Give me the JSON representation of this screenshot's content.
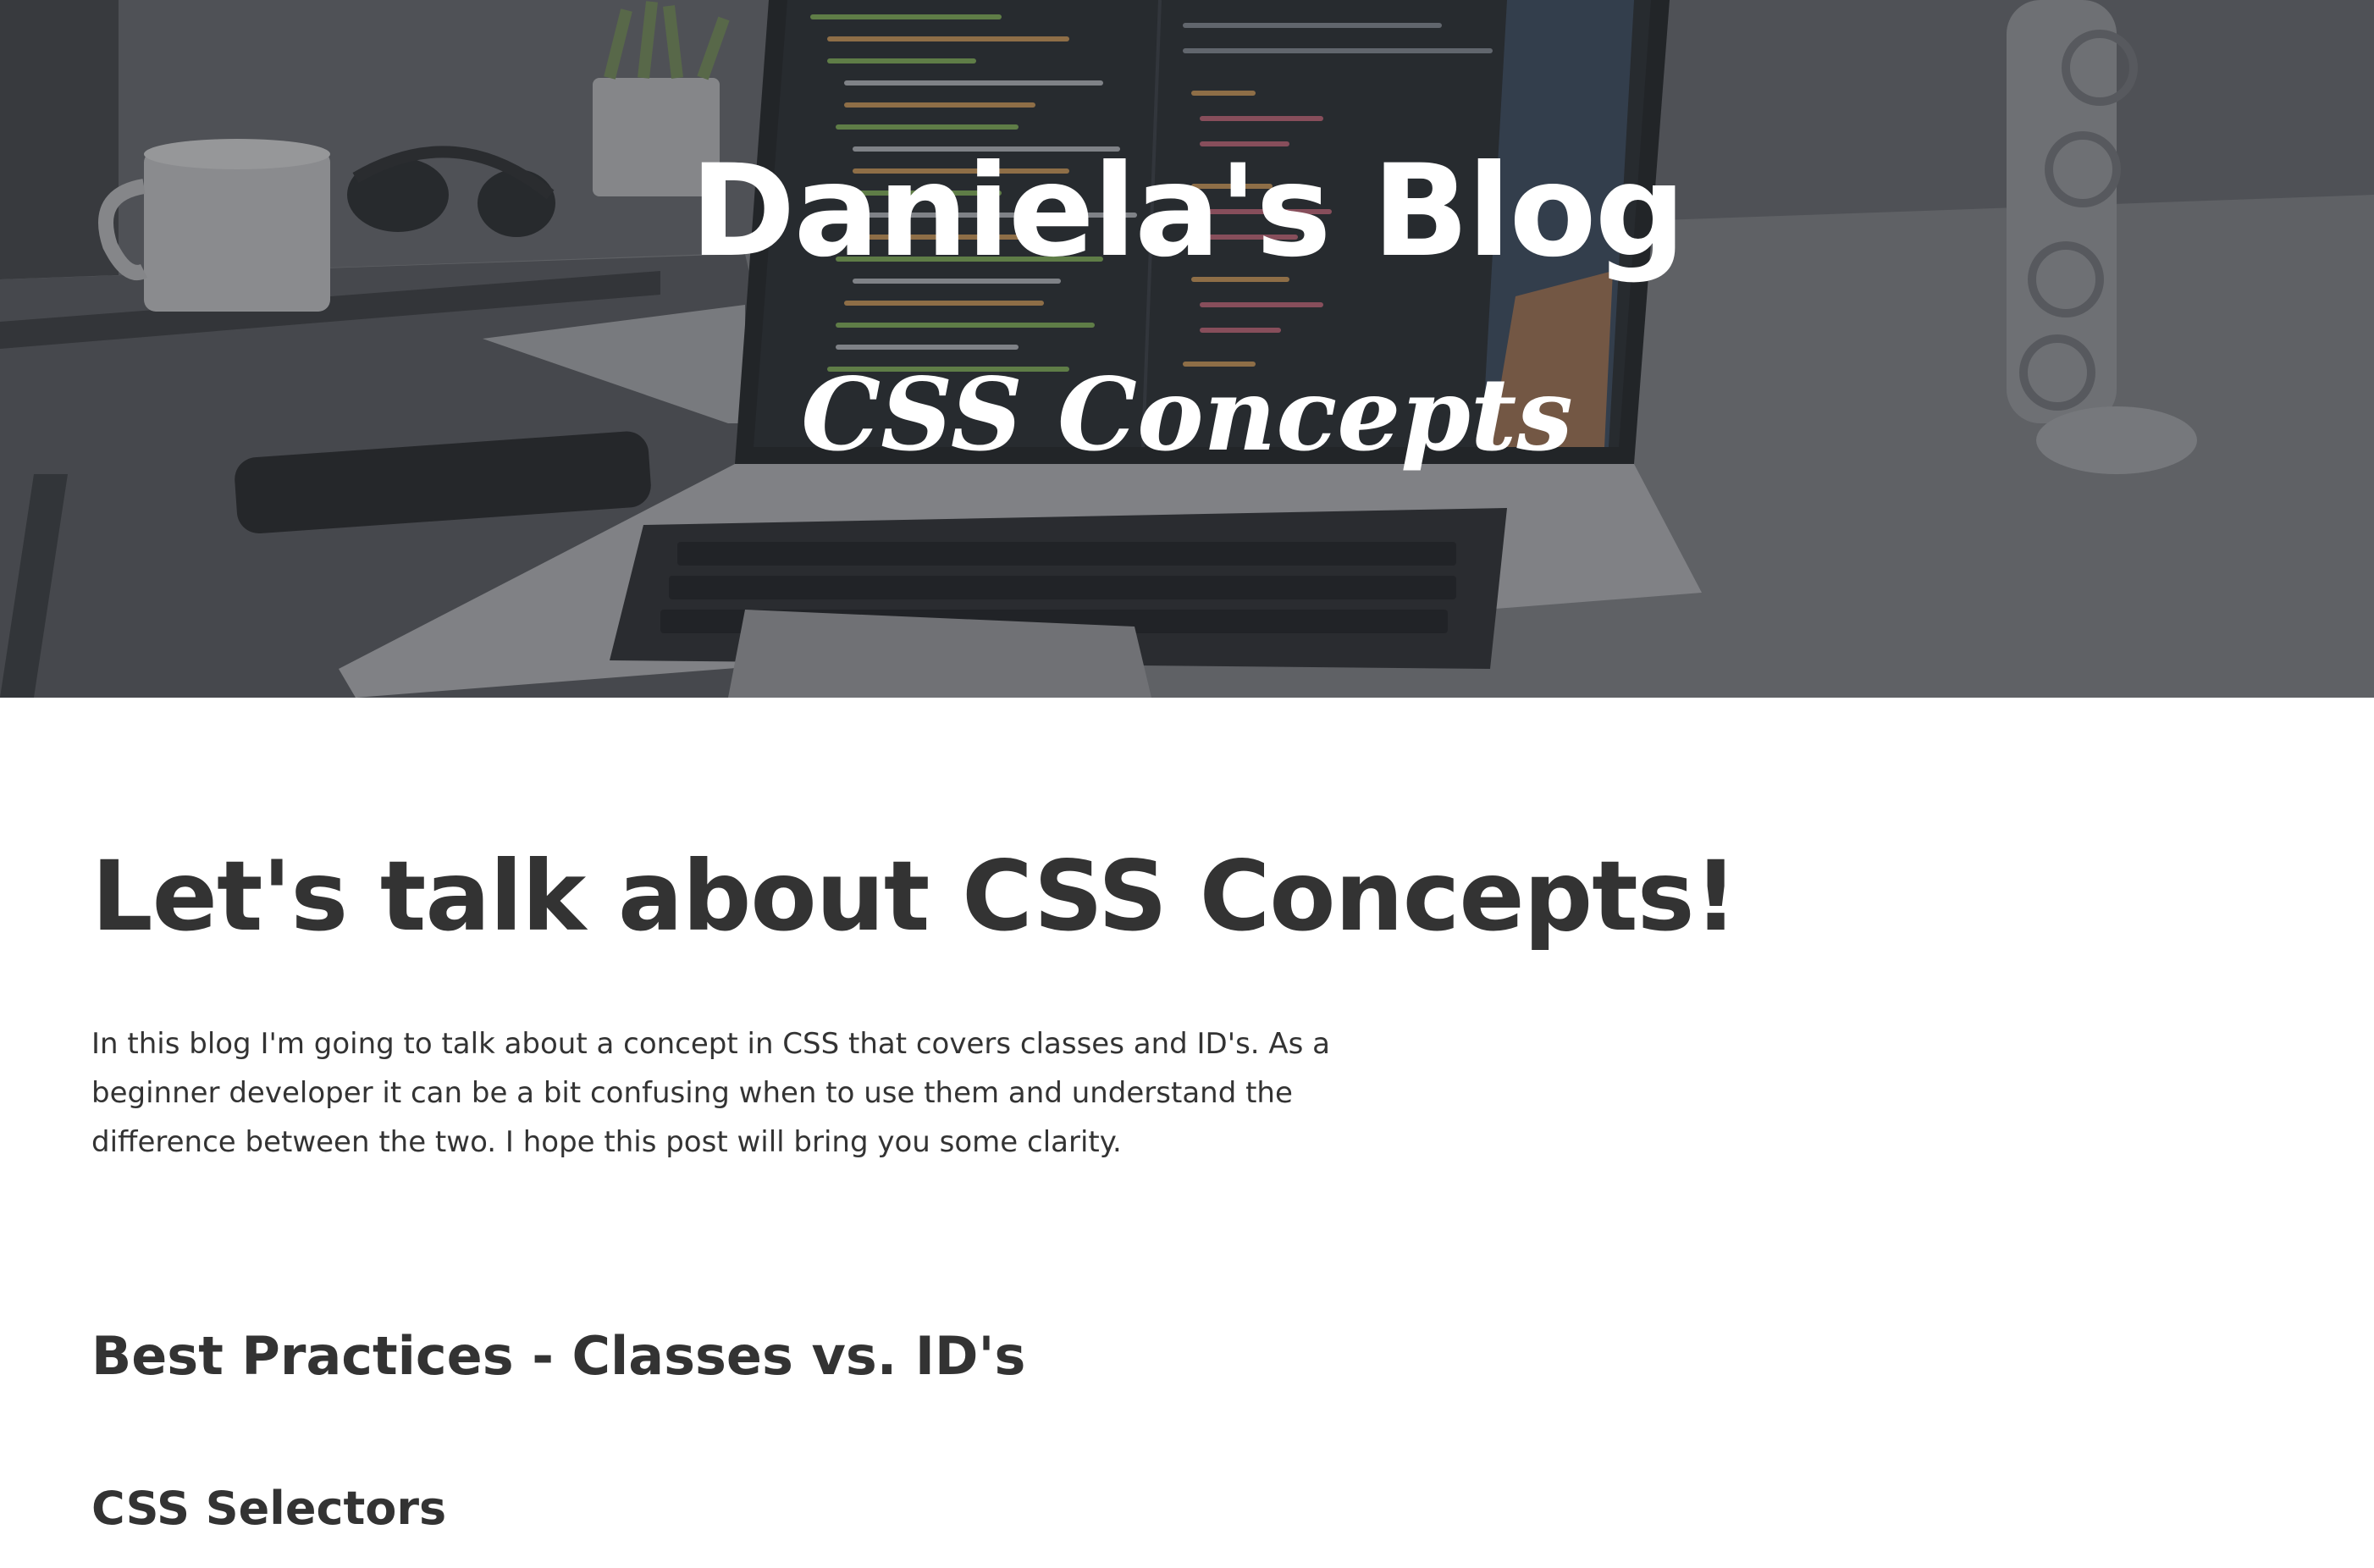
{
  "hero": {
    "title": "Daniela's Blog",
    "subtitle": "CSS Concepts",
    "background_image": "laptop-with-code-on-desk-photo"
  },
  "article": {
    "title": "Let's talk about CSS Concepts!",
    "intro": "In this blog I'm going to talk about a concept in CSS that covers classes and ID's. As a beginner developer it can be a bit confusing when to use them and understand the difference between the two. I hope this post will bring you some clarity.",
    "section_heading": "Best Practices - Classes vs. ID's",
    "sub_heading": "CSS Selectors"
  },
  "colors": {
    "text": "#333333",
    "hero_text": "#ffffff",
    "hero_overlay": "#4f5156",
    "background": "#ffffff"
  }
}
